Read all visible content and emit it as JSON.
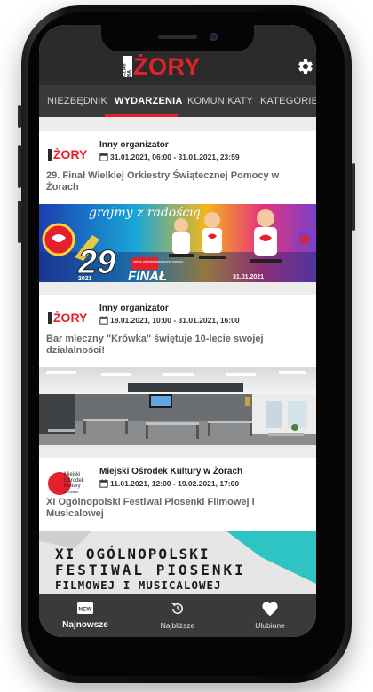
{
  "header": {
    "logo_text": "ŻORY",
    "logo_tag": "CZAS NA",
    "settings_icon": "gear-icon"
  },
  "tabs": [
    {
      "label": "NIEZBĘDNIK",
      "active": false
    },
    {
      "label": "WYDARZENIA",
      "active": true
    },
    {
      "label": "KOMUNIKATY",
      "active": false
    },
    {
      "label": "KATEGORIE",
      "active": false
    }
  ],
  "events": [
    {
      "logo": "ŻORY",
      "organizer": "Inny organizator",
      "date": "31.01.2021, 06:00 - 31.01.2021, 23:59",
      "title": "29. Finał Wielkiej Orkiestry Świątecznej Pomocy w Żorach",
      "image_text": {
        "slogan": "grajmy z radością",
        "number": "29",
        "year": "2021",
        "final": "FINAŁ",
        "badge": "wielka orkiestra świątecznej pomocy",
        "date": "31.01.2021"
      }
    },
    {
      "logo": "ŻORY",
      "organizer": "Inny organizator",
      "date": "18.01.2021, 10:00 - 31.01.2021, 16:00",
      "title": "Bar mleczny \"Krówka\" świętuje 10-lecie swojej działalności!"
    },
    {
      "logo_lines": [
        "Miejski",
        "Ośrodek",
        "Kultury",
        "w Żorach"
      ],
      "organizer": "Miejski Ośrodek Kultury w Żorach",
      "date": "11.01.2021, 12:00 - 19.02.2021, 17:00",
      "title": "XI Ogólnopolski Festiwal Piosenki Filmowej i Musicalowej",
      "image_text": {
        "line1": "XI OGÓLNOPOLSKI",
        "line2": "FESTIWAL PIOSENKI",
        "line3": "FILMOWEJ I MUSICALOWEJ"
      }
    }
  ],
  "bottom_nav": [
    {
      "label": "Najnowsze",
      "icon": "new-icon",
      "icon_text": "NEW",
      "active": true
    },
    {
      "label": "Najbliższe",
      "icon": "history-icon",
      "active": false
    },
    {
      "label": "Ulubione",
      "icon": "heart-icon",
      "active": false
    }
  ],
  "colors": {
    "accent": "#e3202b",
    "header_bg": "#2b2b2b",
    "tabs_bg": "#3a3a3a",
    "feed_bg": "#ececec"
  }
}
